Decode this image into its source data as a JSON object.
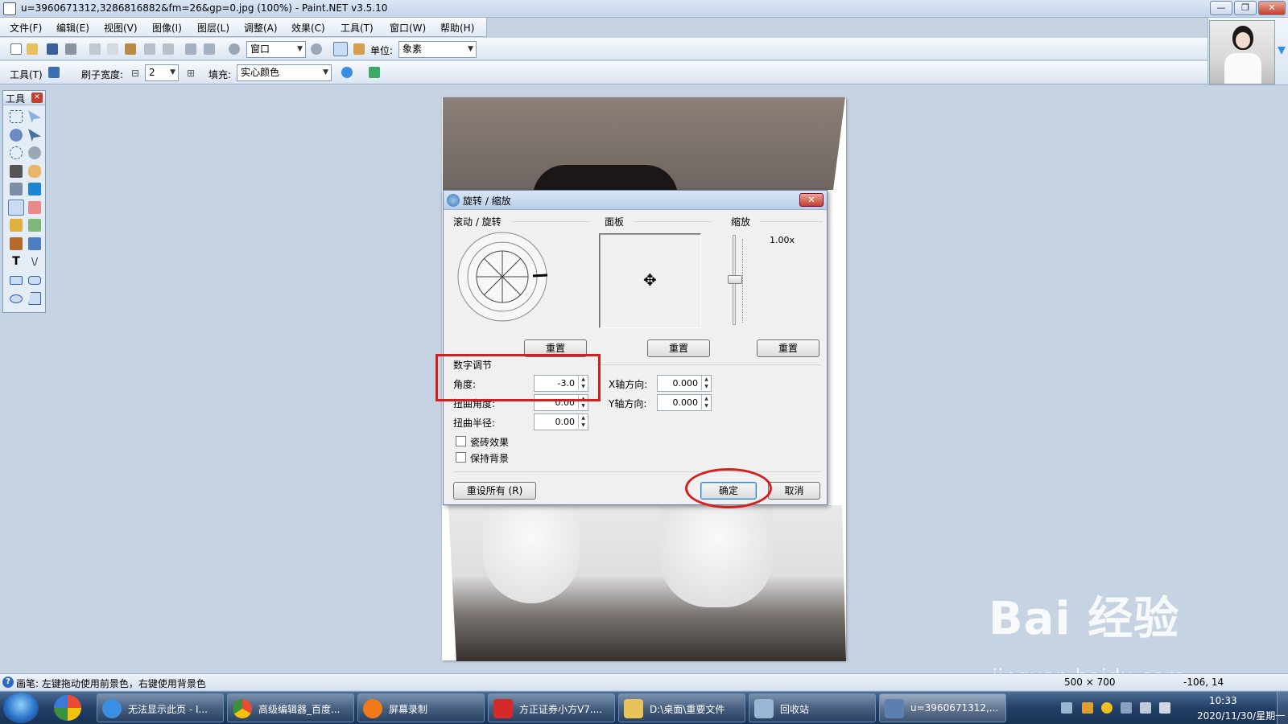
{
  "window": {
    "title": "u=3960671312,3286816882&fm=26&gp=0.jpg (100%) - Paint.NET v3.5.10",
    "min_label": "—",
    "max_label": "❐",
    "close_label": "✕"
  },
  "menu": [
    "文件(F)",
    "编辑(E)",
    "视图(V)",
    "图像(I)",
    "图层(L)",
    "调整(A)",
    "效果(C)",
    "工具(T)",
    "窗口(W)",
    "帮助(H)"
  ],
  "toolbar1": {
    "zoom_value": "窗口",
    "unit_label": "单位:",
    "unit_value": "象素"
  },
  "toolbar2": {
    "tool_label": "工具(T)",
    "brush_width_label": "刷子宽度:",
    "brush_width_value": "2",
    "fill_label": "填充:",
    "fill_value": "实心颜色"
  },
  "tools_panel": {
    "title": "工具"
  },
  "dialog": {
    "title": "旋转 / 缩放",
    "sections": {
      "roll_rotate": "滚动 / 旋转",
      "pan": "面板",
      "zoom": "缩放",
      "numeric": "数字调节"
    },
    "zoom_value": "1.00x",
    "reset_label": "重置",
    "fields": {
      "angle_label": "角度:",
      "angle_value": "-3.0",
      "twist_angle_label": "扭曲角度:",
      "twist_angle_value": "0.00",
      "twist_radius_label": "扭曲半径:",
      "twist_radius_value": "0.00",
      "x_label": "X轴方向:",
      "x_value": "0.000",
      "y_label": "Y轴方向:",
      "y_value": "0.000"
    },
    "checkboxes": {
      "tile_label": "瓷砖效果",
      "tile_checked": false,
      "keep_bg_label": "保持背景",
      "keep_bg_checked": false
    },
    "reset_all_label": "重设所有 (R)",
    "ok_label": "确定",
    "cancel_label": "取消"
  },
  "status": {
    "hint": "画笔: 左键拖动使用前景色，右键使用背景色",
    "image_size": "500 × 700",
    "cursor_pos": "-106, 14"
  },
  "taskbar": {
    "items": [
      {
        "label": "无法显示此页 - I...",
        "color": "#3b8fe0"
      },
      {
        "label": "高级编辑器_百度...",
        "color": "#e9a11c"
      },
      {
        "label": "屏幕录制",
        "color": "#f07a1a"
      },
      {
        "label": "方正证券小方V7....",
        "color": "#d62a2a"
      },
      {
        "label": "D:\\桌面\\重要文件",
        "color": "#e8c35a"
      },
      {
        "label": "回收站",
        "color": "#9bb6d4"
      },
      {
        "label": "u=3960671312,...",
        "color": "#5a7fb0"
      }
    ],
    "time": "10:33",
    "date": "2020/11/30/星期一"
  },
  "watermark": {
    "main": "Bai 经验",
    "sub": "jingyan.baidu.com"
  },
  "colors": {
    "annotation_red": "#d41f1f",
    "workspace_bg": "#c6d3e3"
  }
}
